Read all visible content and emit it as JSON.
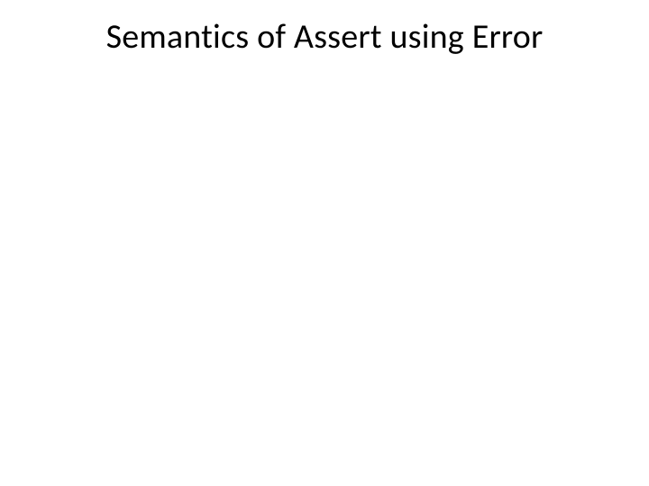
{
  "slide": {
    "title": "Semantics of Assert using Error"
  }
}
